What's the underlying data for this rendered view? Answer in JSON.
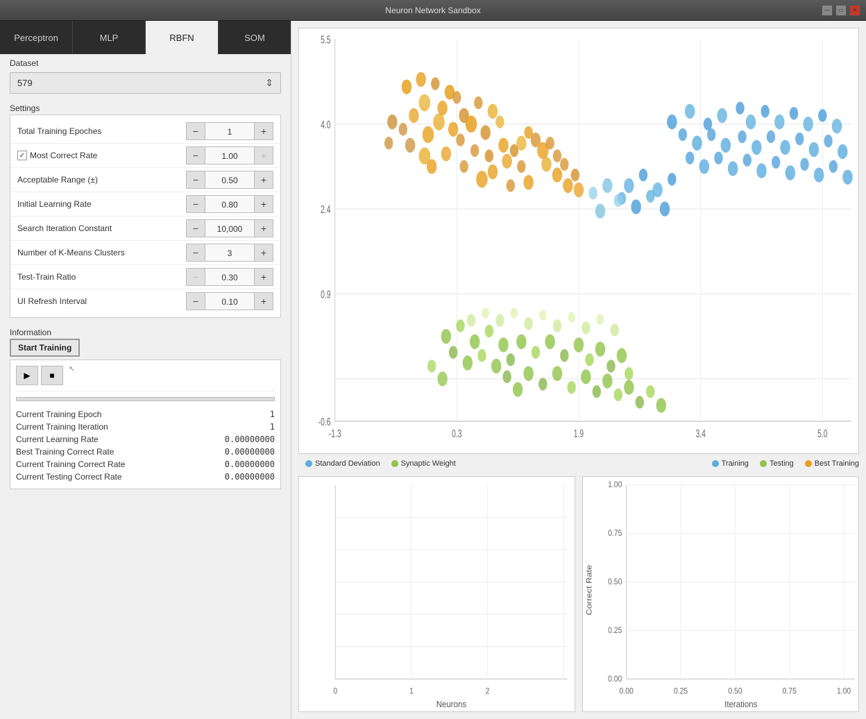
{
  "window": {
    "title": "Neuron Network Sandbox"
  },
  "tabs": [
    {
      "label": "Perceptron",
      "active": false
    },
    {
      "label": "MLP",
      "active": false
    },
    {
      "label": "RBFN",
      "active": true
    },
    {
      "label": "SOM",
      "active": false
    }
  ],
  "dataset": {
    "label": "Dataset",
    "value": "579"
  },
  "settings": {
    "label": "Settings",
    "rows": [
      {
        "label": "Total Training Epoches",
        "value": "1",
        "checked": false,
        "minus_disabled": false,
        "plus_disabled": false
      },
      {
        "label": "Most Correct Rate",
        "value": "1.00",
        "checked": true,
        "minus_disabled": false,
        "plus_disabled": true
      },
      {
        "label": "Acceptable Range (±)",
        "value": "0.50",
        "checked": false,
        "minus_disabled": false,
        "plus_disabled": false
      },
      {
        "label": "Initial Learning Rate",
        "value": "0.80",
        "checked": false,
        "minus_disabled": false,
        "plus_disabled": false
      },
      {
        "label": "Search Iteration Constant",
        "value": "10,000",
        "checked": false,
        "minus_disabled": false,
        "plus_disabled": false
      },
      {
        "label": "Number of K-Means Clusters",
        "value": "3",
        "checked": false,
        "minus_disabled": false,
        "plus_disabled": false
      },
      {
        "label": "Test-Train Ratio",
        "value": "0.30",
        "checked": false,
        "minus_disabled": true,
        "plus_disabled": false
      },
      {
        "label": "UI Refresh Interval",
        "value": "0.10",
        "checked": false,
        "minus_disabled": false,
        "plus_disabled": false
      }
    ]
  },
  "information": {
    "section_label": "Information",
    "start_button": "Start Training",
    "stats": [
      {
        "key": "Current Training Epoch",
        "value": "1"
      },
      {
        "key": "Current Training Iteration",
        "value": "1"
      },
      {
        "key": "Current Learning Rate",
        "value": "0.00000000"
      },
      {
        "key": "Best Training Correct Rate",
        "value": "0.00000000"
      },
      {
        "key": "Current Training Correct Rate",
        "value": "0.00000000"
      },
      {
        "key": "Current Testing Correct Rate",
        "value": "0.00000000"
      }
    ]
  },
  "scatter_legend": [
    {
      "color": "#5badde",
      "label": "Standard Deviation"
    },
    {
      "color": "#90c44a",
      "label": "Synaptic Weight"
    }
  ],
  "chart_legend": [
    {
      "color": "#5badde",
      "label": "Training"
    },
    {
      "color": "#90c44a",
      "label": "Testing"
    },
    {
      "color": "#e8a020",
      "label": "Best Training"
    }
  ],
  "neurons_chart": {
    "x_label": "Neurons",
    "x_ticks": [
      "0",
      "1",
      "2"
    ]
  },
  "correct_rate_chart": {
    "y_label": "Correct Rate",
    "x_label": "Iterations",
    "x_ticks": [
      "0.00",
      "0.25",
      "0.50",
      "0.75",
      "1.00"
    ],
    "y_ticks": [
      "0.00",
      "0.25",
      "0.50",
      "0.75",
      "1.00"
    ]
  }
}
